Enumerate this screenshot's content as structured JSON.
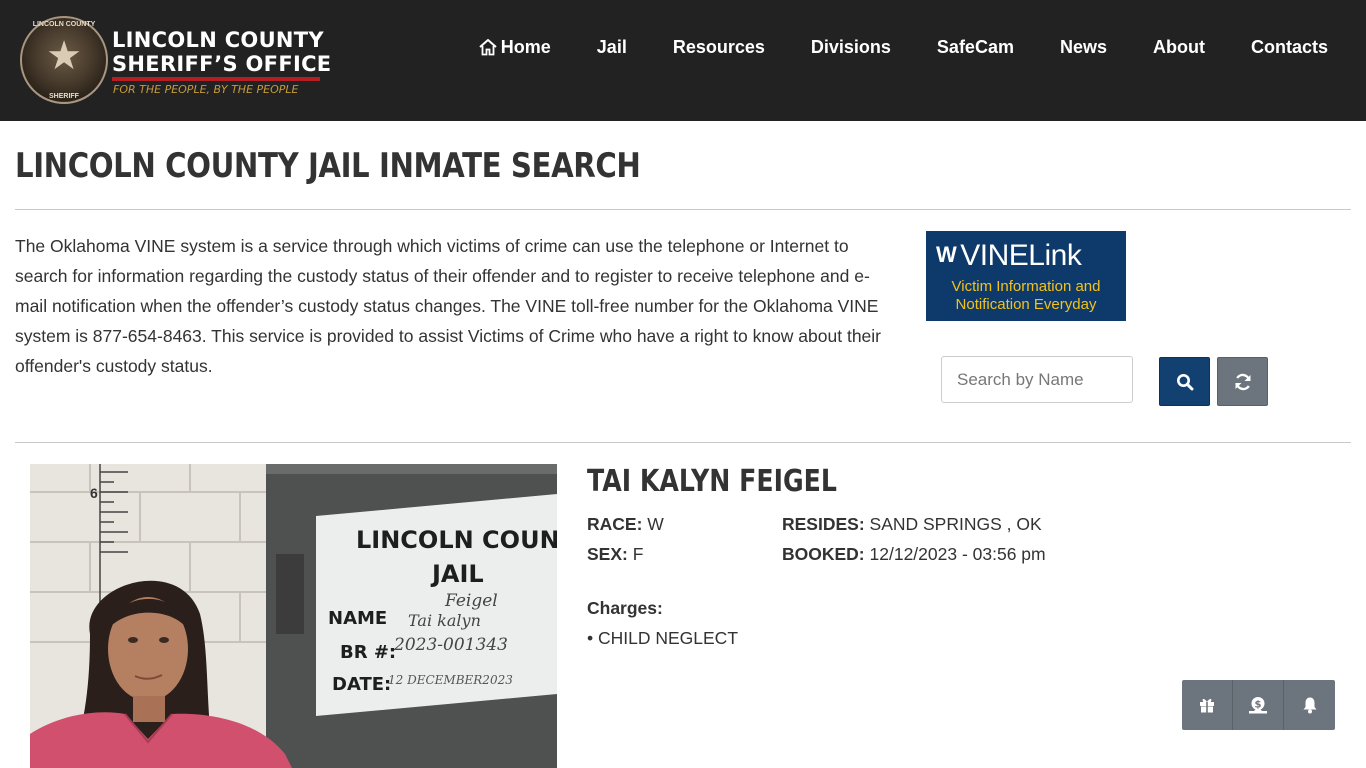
{
  "header": {
    "logo": {
      "line1": "LINCOLN COUNTY",
      "line2": "SHERIFF’S OFFICE",
      "tagline": "FOR THE PEOPLE, BY THE PEOPLE",
      "badge_top": "LINCOLN COUNTY",
      "badge_bottom": "SHERIFF"
    },
    "nav": [
      {
        "label": "Home",
        "icon": "home-icon"
      },
      {
        "label": "Jail"
      },
      {
        "label": "Resources"
      },
      {
        "label": "Divisions"
      },
      {
        "label": "SafeCam"
      },
      {
        "label": "News"
      },
      {
        "label": "About"
      },
      {
        "label": "Contacts"
      }
    ]
  },
  "page": {
    "title": "LINCOLN COUNTY JAIL INMATE SEARCH",
    "intro": "The Oklahoma VINE system is a service through which victims of crime can use the telephone or Internet to search for information regarding the custody status of their offender and to register to receive telephone and e-mail notification when the offender’s custody status changes. The VINE toll-free number for the Oklahoma VINE system is 877-654-8463. This service is provided to assist Victims of Crime who have a right to know about their offender's custody status."
  },
  "vinelink": {
    "logo_text": "VINELink",
    "tagline_line1": "Victim Information and",
    "tagline_line2": "Notification Everyday"
  },
  "search": {
    "placeholder": "Search by Name",
    "value": "",
    "search_icon": "search-icon",
    "refresh_icon": "refresh-icon"
  },
  "inmate": {
    "name": "TAI KALYN FEIGEL",
    "race_label": "RACE:",
    "race": "W",
    "sex_label": "SEX:",
    "sex": "F",
    "resides_label": "RESIDES:",
    "resides": "SAND SPRINGS , OK",
    "booked_label": "BOOKED:",
    "booked": "12/12/2023 - 03:56 pm",
    "charges_label": "Charges:",
    "charges": [
      "• CHILD NEGLECT"
    ],
    "photo_sign": {
      "line1": "LINCOLN COUNTY",
      "line2": "JAIL",
      "name_label": "NAME",
      "name_value": "Feigel",
      "name_value2": "Tai kalyn",
      "br_label": "BR #:",
      "br_value": "2023-001343",
      "date_label": "DATE:",
      "date_value": "12 DECEMBER2023",
      "height_mark": "6"
    }
  },
  "actions": [
    {
      "icon": "gift-icon"
    },
    {
      "icon": "money-icon"
    },
    {
      "icon": "bell-icon"
    }
  ],
  "colors": {
    "header_bg": "#222222",
    "primary_button": "#124070",
    "secondary_button": "#6c757d",
    "vine_bg": "#0d3a6b",
    "vine_tagline": "#f4c21b",
    "logo_rule": "#b51f24",
    "logo_tagline": "#c89a3a"
  }
}
